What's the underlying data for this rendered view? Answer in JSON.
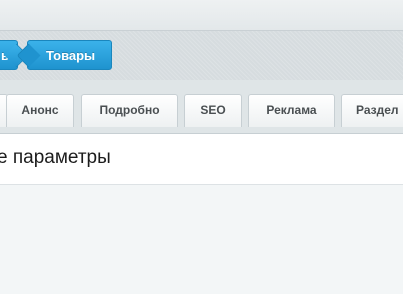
{
  "breadcrumbs": {
    "prev_label": "ь",
    "current_label": "Товары"
  },
  "tabs": [
    {
      "label": "Анонс"
    },
    {
      "label": "Подробно"
    },
    {
      "label": "SEO"
    },
    {
      "label": "Реклама"
    },
    {
      "label": "Раздел"
    }
  ],
  "section": {
    "title": "е параметры"
  },
  "colors": {
    "accent": "#2aa3df",
    "tabbar_bg": "#dfe5e7",
    "content_bg": "#ffffff"
  }
}
